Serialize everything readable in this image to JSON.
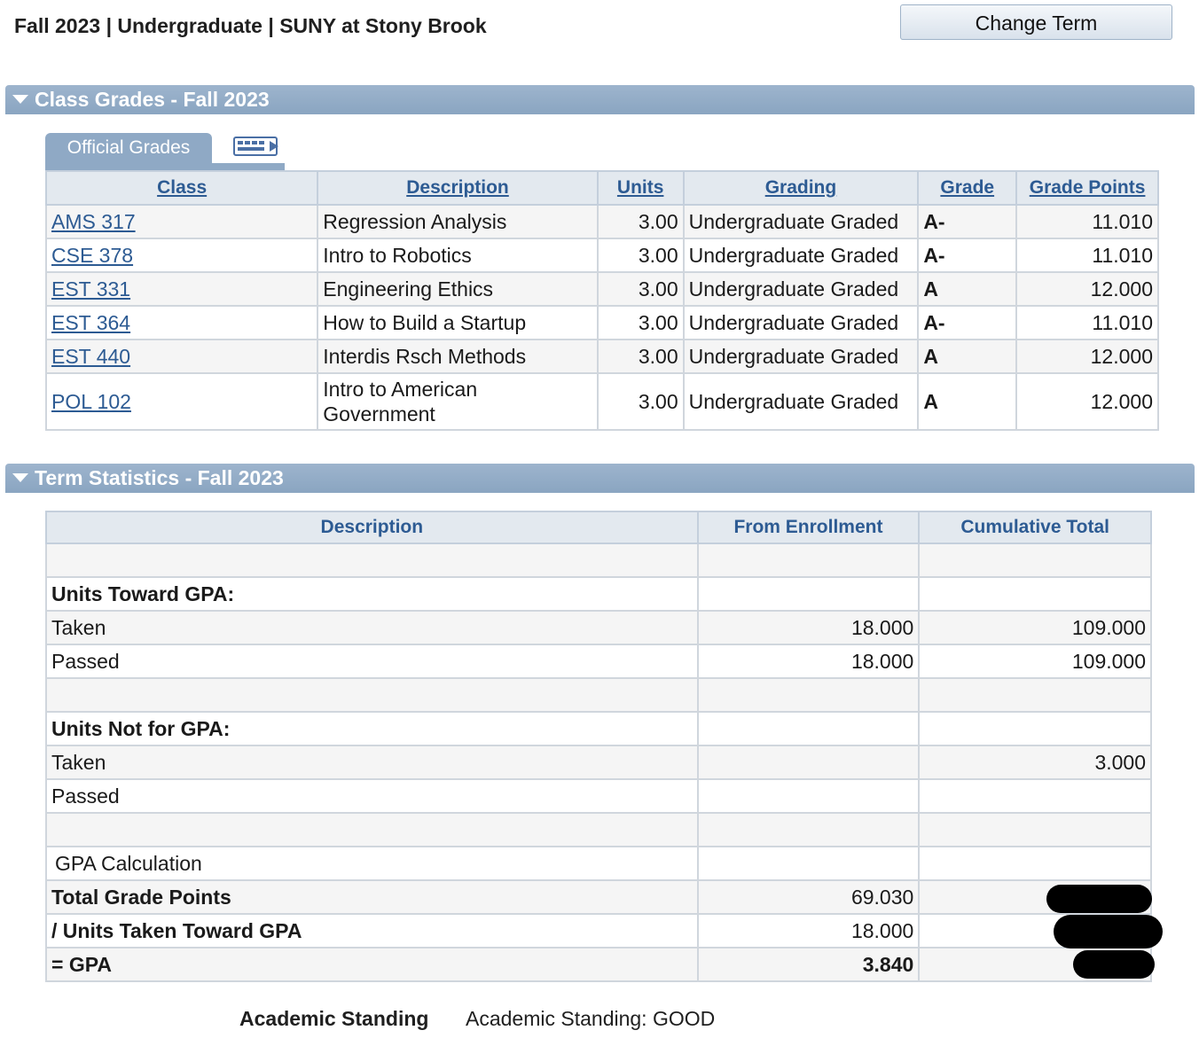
{
  "header": {
    "term_title": "Fall 2023 | Undergraduate | SUNY at Stony Brook",
    "change_term_label": "Change Term"
  },
  "class_grades": {
    "section_title": "Class Grades - Fall 2023",
    "tab_label": "Official Grades",
    "columns": [
      "Class",
      "Description",
      "Units",
      "Grading",
      "Grade",
      "Grade Points"
    ],
    "rows": [
      {
        "class": "AMS 317",
        "description": "Regression Analysis",
        "units": "3.00",
        "grading": "Undergraduate Graded",
        "grade": "A-",
        "points": "11.010"
      },
      {
        "class": "CSE 378",
        "description": "Intro to Robotics",
        "units": "3.00",
        "grading": "Undergraduate Graded",
        "grade": "A-",
        "points": "11.010"
      },
      {
        "class": "EST 331",
        "description": "Engineering Ethics",
        "units": "3.00",
        "grading": "Undergraduate Graded",
        "grade": "A",
        "points": "12.000"
      },
      {
        "class": "EST 364",
        "description": "How to Build a Startup",
        "units": "3.00",
        "grading": "Undergraduate Graded",
        "grade": "A-",
        "points": "11.010"
      },
      {
        "class": "EST 440",
        "description": "Interdis Rsch Methods",
        "units": "3.00",
        "grading": "Undergraduate Graded",
        "grade": "A",
        "points": "12.000"
      },
      {
        "class": "POL 102",
        "description": "Intro to American Government",
        "units": "3.00",
        "grading": "Undergraduate Graded",
        "grade": "A",
        "points": "12.000"
      }
    ]
  },
  "term_stats": {
    "section_title": "Term Statistics - Fall 2023",
    "columns": [
      "Description",
      "From Enrollment",
      "Cumulative Total"
    ],
    "rows": {
      "units_toward_gpa": "Units Toward GPA:",
      "taken_label": "Taken",
      "taken_enroll": "18.000",
      "taken_cum": "109.000",
      "passed_label": "Passed",
      "passed_enroll": "18.000",
      "passed_cum": "109.000",
      "units_not_gpa": "Units Not for GPA:",
      "ng_taken_label": "Taken",
      "ng_taken_cum": "3.000",
      "ng_passed_label": "Passed",
      "gpa_calc": "GPA Calculation",
      "total_points_label": "Total Grade Points",
      "total_points": "69.030",
      "units_taken_label": "/  Units Taken Toward GPA",
      "units_taken": "18.000",
      "gpa_label": "= GPA",
      "gpa": "3.840"
    }
  },
  "academic_standing": {
    "label": "Academic Standing",
    "value": "Academic Standing: GOOD"
  }
}
